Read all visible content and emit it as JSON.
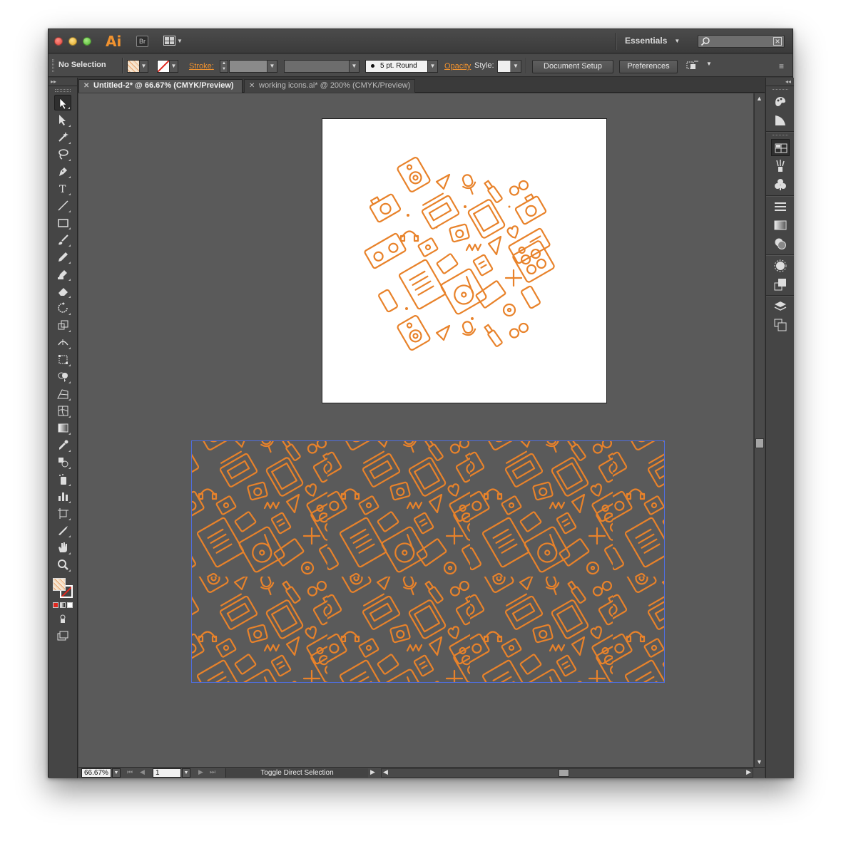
{
  "app": {
    "logo": "Ai",
    "bridge_badge": "Br",
    "workspace": "Essentials"
  },
  "control_bar": {
    "selection": "No Selection",
    "stroke_label": "Stroke:",
    "brush_value": "5 pt. Round",
    "opacity_label": "Opacity",
    "style_label": "Style:",
    "document_setup": "Document Setup",
    "preferences": "Preferences"
  },
  "tabs": [
    {
      "label": "Untitled-2* @ 66.67% (CMYK/Preview)",
      "active": true
    },
    {
      "label": "working icons.ai* @ 200% (CMYK/Preview)",
      "active": false
    }
  ],
  "statusbar": {
    "zoom": "66.67%",
    "page": "1",
    "status": "Toggle Direct Selection"
  },
  "tools": [
    "selection-tool",
    "direct-selection-tool",
    "magic-wand-tool",
    "lasso-tool",
    "pen-tool",
    "type-tool",
    "line-segment-tool",
    "rectangle-tool",
    "paintbrush-tool",
    "pencil-tool",
    "blob-brush-tool",
    "eraser-tool",
    "rotate-tool",
    "scale-tool",
    "width-tool",
    "free-transform-tool",
    "shape-builder-tool",
    "perspective-grid-tool",
    "mesh-tool",
    "gradient-tool",
    "eyedropper-tool",
    "blend-tool",
    "symbol-sprayer-tool",
    "column-graph-tool",
    "artboard-tool",
    "slice-tool",
    "hand-tool",
    "zoom-tool"
  ],
  "dock_panels": [
    "color-panel-icon",
    "color-guide-icon",
    "swatches-icon",
    "brushes-icon",
    "symbols-icon",
    "stroke-icon",
    "gradient-icon",
    "transparency-icon",
    "appearance-icon",
    "graphic-styles-icon",
    "layers-icon",
    "artboards-icon"
  ],
  "colors": {
    "accent": "#f0922f",
    "artwork_stroke": "#e8822a",
    "canvas": "#5a5a5a",
    "selection_bounds": "#4f6ee0"
  }
}
